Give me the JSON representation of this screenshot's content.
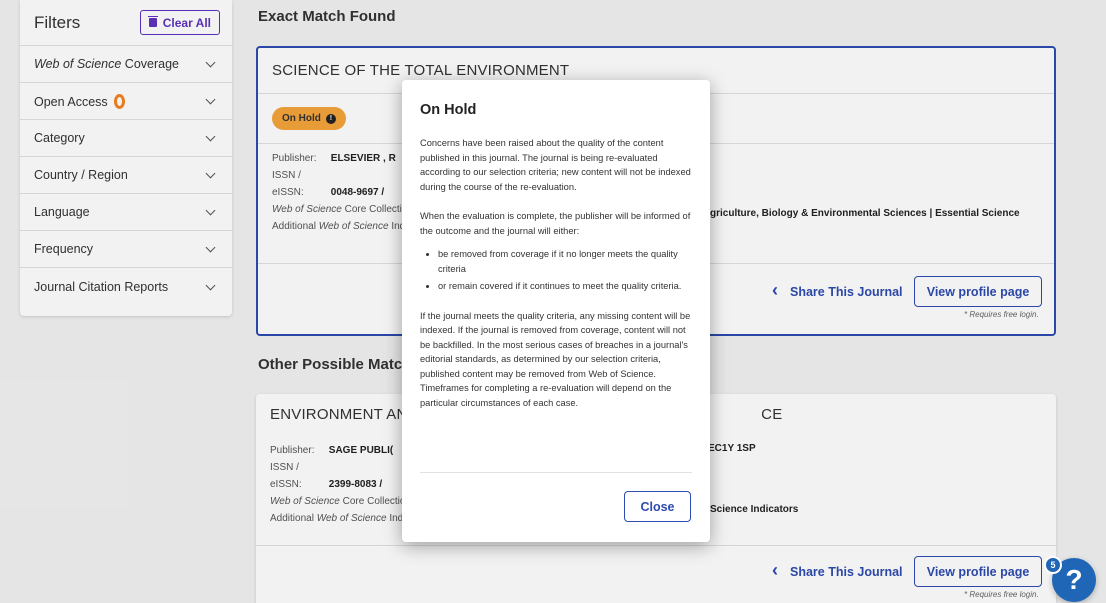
{
  "filters": {
    "title": "Filters",
    "clear_label": "Clear All",
    "items": [
      {
        "label_em": "Web of Science",
        "label": " Coverage"
      },
      {
        "label_em": "",
        "label": "Open Access"
      },
      {
        "label_em": "",
        "label": "Category"
      },
      {
        "label_em": "",
        "label": "Country / Region"
      },
      {
        "label_em": "",
        "label": "Language"
      },
      {
        "label_em": "",
        "label": "Frequency"
      },
      {
        "label_em": "",
        "label": "Journal Citation Reports"
      }
    ]
  },
  "exact": {
    "heading": "Exact Match Found",
    "title": "SCIENCE OF THE TOTAL ENVIRONMENT",
    "badge": "On Hold",
    "publisher_label": "Publisher:",
    "publisher": "ELSEVIER , R",
    "issn_label": "ISSN / eISSN:",
    "issn": "0048-9697 /",
    "collection_em": "Web of Science",
    "collection": " Core Collection",
    "additional_label": "Additional ",
    "additional_em": "Web of Science",
    "additional": " Inde",
    "indexes_tail": "griculture, Biology & Environmental Sciences | Essential Science",
    "share": "Share This Journal",
    "profile": "View profile page",
    "requires": "* Requires free login."
  },
  "other": {
    "heading": "Other Possible Matche",
    "title_left": "ENVIRONMENT AND P",
    "title_right": "CE",
    "publisher_label": "Publisher:",
    "publisher": "SAGE PUBLI(",
    "address_tail": "EC1Y 1SP",
    "issn_label": "ISSN / eISSN:",
    "issn": "2399-8083 /",
    "collection_em": "Web of Science",
    "collection": " Core Collection",
    "additional_label": "Additional ",
    "additional_em": "Web of Science",
    "additional": " Inde",
    "indexes_tail": "Science Indicators",
    "share": "Share This Journal",
    "profile": "View profile page",
    "requires": "* Requires free login."
  },
  "modal": {
    "title": "On Hold",
    "p1": "Concerns have been raised about the quality of the content published in this journal. The journal is being re-evaluated according to our selection criteria; new content will not be indexed during the course of the re-evaluation.",
    "p2": "When the evaluation is complete, the publisher will be informed of the outcome and the journal will either:",
    "bullets": [
      "be removed from coverage if it no longer meets the quality criteria",
      "or remain covered if it continues to meet the quality criteria."
    ],
    "p3": "If the journal meets the quality criteria, any missing content will be indexed. If the journal is removed from coverage, content will not be backfilled. In the most serious cases of breaches in a journal's editorial standards, as determined by our selection criteria, published content may be removed from Web of Science. Timeframes for completing a re-evaluation will depend on the particular circumstances of each case.",
    "close": "Close"
  },
  "help": {
    "count": "5",
    "symbol": "?"
  },
  "colors": {
    "accent": "#2e4bb0",
    "purple": "#5e33bf",
    "badge": "#f4a53b",
    "help": "#1f66b6",
    "open_access": "#f58220"
  }
}
